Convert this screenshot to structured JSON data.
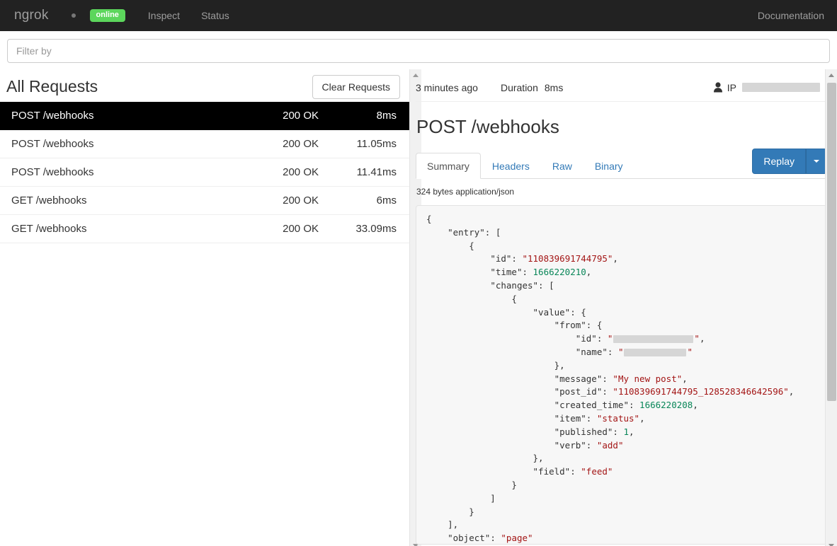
{
  "navbar": {
    "brand": "ngrok",
    "status_dot": "•",
    "online_badge": "online",
    "links": [
      {
        "label": "Inspect"
      },
      {
        "label": "Status"
      }
    ],
    "documentation": "Documentation",
    "bg_color": "#222222",
    "badge_color": "#5cd65c"
  },
  "filter": {
    "value": "",
    "placeholder": "Filter by"
  },
  "left_panel": {
    "title": "All Requests",
    "clear_button": "Clear Requests",
    "requests": [
      {
        "name": "POST /webhooks",
        "status": "200 OK",
        "duration": "8ms",
        "selected": true
      },
      {
        "name": "POST /webhooks",
        "status": "200 OK",
        "duration": "11.05ms",
        "selected": false
      },
      {
        "name": "POST /webhooks",
        "status": "200 OK",
        "duration": "11.41ms",
        "selected": false
      },
      {
        "name": "GET /webhooks",
        "status": "200 OK",
        "duration": "6ms",
        "selected": false
      },
      {
        "name": "GET /webhooks",
        "status": "200 OK",
        "duration": "33.09ms",
        "selected": false
      }
    ]
  },
  "right_panel": {
    "time_ago": "3 minutes ago",
    "duration_label": "Duration",
    "duration_value": "8ms",
    "ip_label": "IP",
    "ip_value": "",
    "request_title": "POST /webhooks",
    "tabs": [
      {
        "label": "Summary",
        "active": true
      },
      {
        "label": "Headers",
        "active": false
      },
      {
        "label": "Raw",
        "active": false
      },
      {
        "label": "Binary",
        "active": false
      }
    ],
    "replay_button": "Replay",
    "body_meta": "324 bytes application/json",
    "accent_color": "#337ab7",
    "json_body": {
      "entry_id": "110839691744795",
      "entry_time": "1666220210",
      "from_id_redacted": true,
      "from_name_redacted": true,
      "message": "My new post",
      "post_id": "110839691744795_128528346642596",
      "created_time": "1666220208",
      "item": "status",
      "published": "1",
      "verb": "add",
      "field": "feed",
      "object": "page"
    }
  }
}
